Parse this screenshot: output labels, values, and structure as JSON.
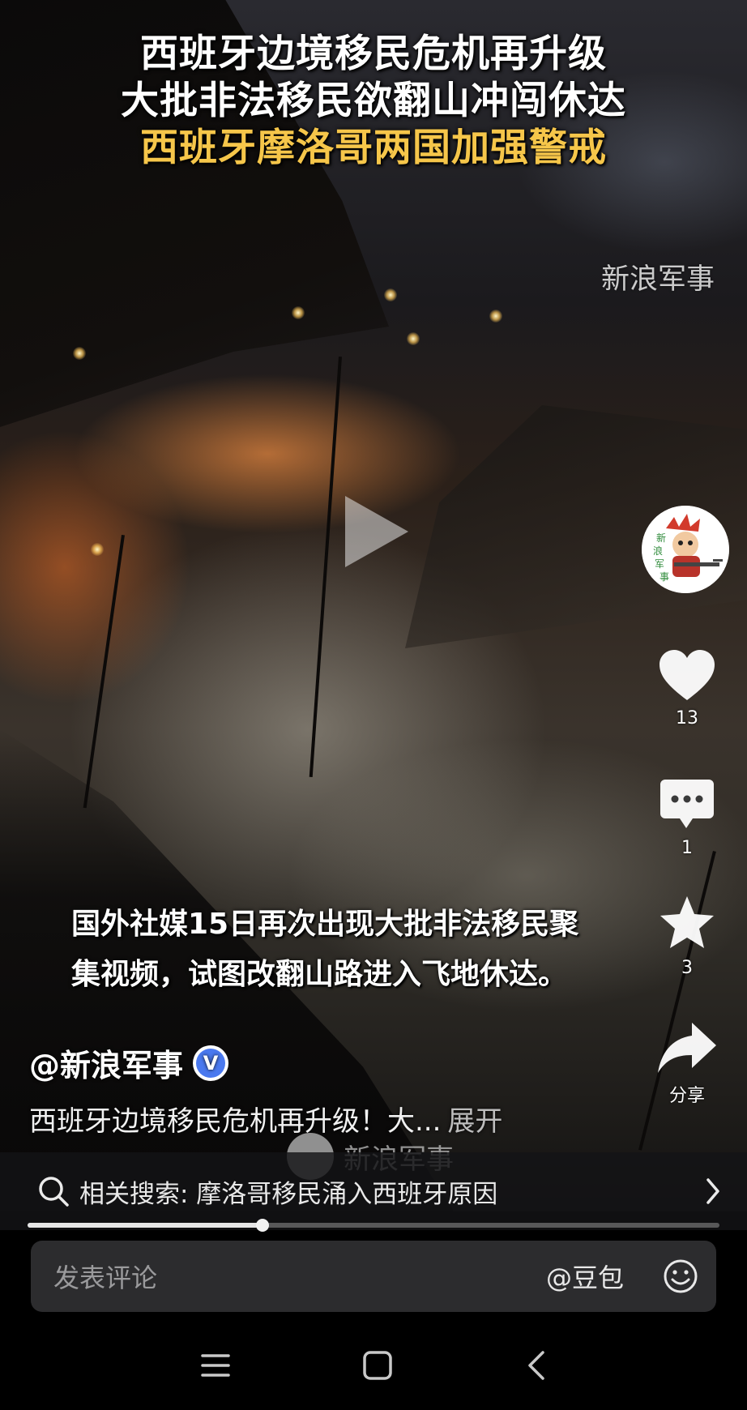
{
  "video": {
    "title_lines": [
      "西班牙边境移民危机再升级",
      "大批非法移民欲翻山冲闯休达"
    ],
    "title_highlight": "西班牙摩洛哥两国加强警戒",
    "watermark": "新浪军事",
    "subtitle_lines": [
      "国外社媒15日再次出现大批非法移民聚",
      "集视频，试图改翻山路进入飞地休达。"
    ],
    "paused": true
  },
  "actions": {
    "like_count": "13",
    "comment_count": "1",
    "favorite_count": "3",
    "share_label": "分享"
  },
  "author": {
    "handle": "@新浪军事",
    "verified_badge": "V"
  },
  "description": {
    "text": "西班牙边境移民危机再升级！大...",
    "expand_label": "展开"
  },
  "overlay_brand": "新浪军事",
  "related_search": {
    "label": "相关搜索: 摩洛哥移民涌入西班牙原因"
  },
  "progress": {
    "fraction": 0.34
  },
  "comment_bar": {
    "placeholder": "发表评论",
    "mention": "@豆包"
  },
  "colors": {
    "title_highlight": "#f6c64a",
    "verified_blue": "#4a79ef",
    "comment_bar_bg": "#2c2c2e"
  },
  "icons": [
    "play-icon",
    "heart-icon",
    "comment-icon",
    "star-icon",
    "share-icon",
    "search-icon",
    "chevron-right-icon",
    "emoji-icon",
    "menu-icon",
    "home-icon",
    "back-icon"
  ]
}
